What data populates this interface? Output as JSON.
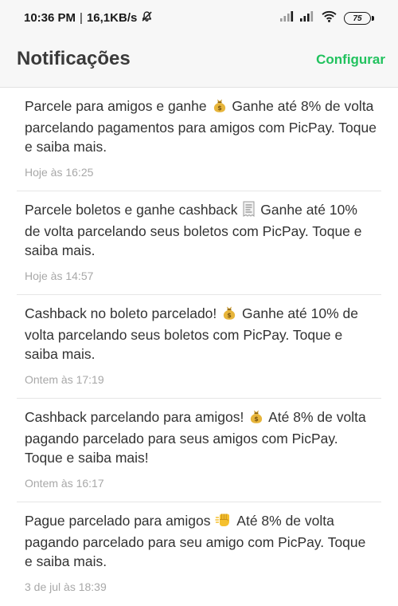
{
  "status_bar": {
    "time": "10:36 PM",
    "separator": "|",
    "speed": "16,1KB/s",
    "battery": "75"
  },
  "header": {
    "title": "Notificações",
    "configure_label": "Configurar",
    "accent_color": "#21c25e"
  },
  "notifications": [
    {
      "before": "Parcele para amigos e ganhe",
      "icon": "money-bag-icon",
      "after": "Ganhe até 8% de volta parcelando pagamentos para amigos com PicPay. Toque e saiba mais.",
      "time": "Hoje às 16:25"
    },
    {
      "before": "Parcele boletos e ganhe cashback",
      "icon": "receipt-icon",
      "after": "Ganhe até 10% de volta parcelando seus boletos com PicPay. Toque e saiba mais.",
      "time": "Hoje às 14:57"
    },
    {
      "before": "Cashback no boleto parcelado!",
      "icon": "money-bag-icon",
      "after": "Ganhe até 10% de volta parcelando seus boletos com PicPay. Toque e saiba mais.",
      "time": "Ontem às 17:19"
    },
    {
      "before": "Cashback parcelando para amigos!",
      "icon": "money-bag-icon",
      "after": "Até 8% de volta pagando parcelado para seus amigos com PicPay. Toque e saiba mais!",
      "time": "Ontem às 16:17"
    },
    {
      "before": "Pague parcelado para amigos",
      "icon": "fist-bump-icon",
      "after": "Até 8% de volta pagando parcelado para seu amigo com PicPay. Toque e saiba mais.",
      "time": "3 de jul às 18:39"
    }
  ]
}
